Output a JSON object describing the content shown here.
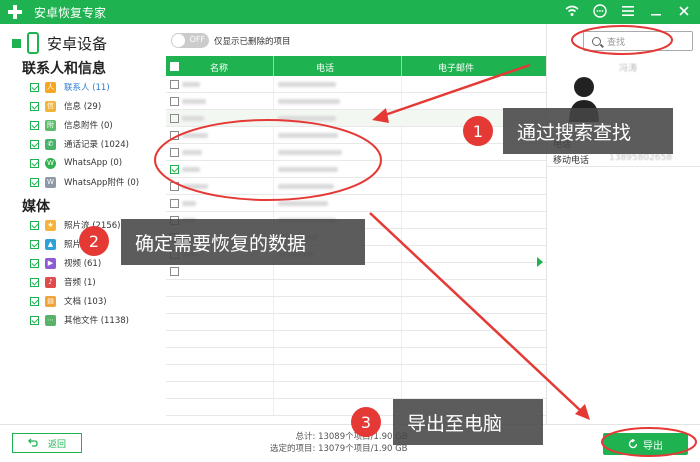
{
  "window": {
    "title": "安卓恢复专家"
  },
  "sidebar": {
    "device": "安卓设备",
    "sections": [
      {
        "title": "联系人和信息",
        "items": [
          {
            "label": "联系人 (11)",
            "color": "#f5a623",
            "glyph": "人"
          },
          {
            "label": "信息 (29)",
            "color": "#f0b43a",
            "glyph": "信"
          },
          {
            "label": "信息附件 (0)",
            "color": "#5bbd6b",
            "glyph": "附"
          },
          {
            "label": "通话记录 (1024)",
            "color": "#47b36a",
            "glyph": "✆"
          },
          {
            "label": "WhatsApp (0)",
            "color": "#2fb24d",
            "glyph": "W"
          },
          {
            "label": "WhatsApp附件 (0)",
            "color": "#8d99a6",
            "glyph": "W"
          }
        ]
      },
      {
        "title": "媒体",
        "items": [
          {
            "label": "照片流 (2156)",
            "color": "#f6b23b",
            "glyph": "★"
          },
          {
            "label": "照片 (336)",
            "color": "#2fa0d8",
            "glyph": "▲"
          },
          {
            "label": "视频 (61)",
            "color": "#8e5bd6",
            "glyph": "▶"
          },
          {
            "label": "音频 (1)",
            "color": "#e04b4b",
            "glyph": "♪"
          },
          {
            "label": "文档 (103)",
            "color": "#f0a43a",
            "glyph": "▤"
          },
          {
            "label": "其他文件 (1138)",
            "color": "#58b368",
            "glyph": "⋯"
          }
        ]
      }
    ]
  },
  "main": {
    "toggle_label": "OFF",
    "toggle_text": "仅显示已删除的项目",
    "columns": [
      "名称",
      "电话",
      "电子邮件"
    ]
  },
  "right": {
    "search_placeholder": "查找",
    "contact_name": "冯涛",
    "field_phone": "电话",
    "field_mobile": "移动电话",
    "mobile_value": "13895802658"
  },
  "bottom": {
    "back_label": "返回",
    "total_line": "总计: 13089个项目/1.90 GB",
    "selected_line": "选定的项目: 13079个项目/1.90 GB",
    "export_label": "导出"
  },
  "annotations": [
    {
      "num": "1",
      "text": "通过搜索查找"
    },
    {
      "num": "2",
      "text": "确定需要恢复的数据"
    },
    {
      "num": "3",
      "text": "导出至电脑"
    }
  ],
  "colors": {
    "accent": "#1fb251",
    "annotation": "#e53935"
  }
}
